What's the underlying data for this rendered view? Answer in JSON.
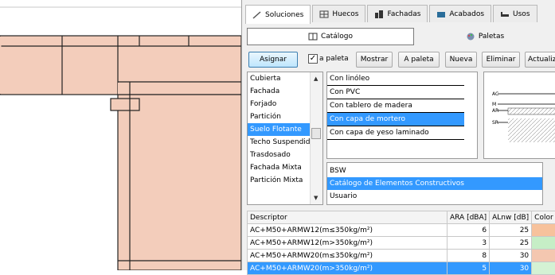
{
  "tabs": [
    "Soluciones",
    "Huecos",
    "Fachadas",
    "Acabados",
    "Usos"
  ],
  "subtabs": {
    "catalog": "Catálogo",
    "palettes": "Paletas"
  },
  "toolbar": {
    "assign": "Asignar",
    "to_palette_checkbox": "a paleta",
    "show": "Mostrar",
    "to_palette": "A paleta",
    "new": "Nueva",
    "delete": "Eliminar",
    "update": "Actualiz"
  },
  "categories": {
    "items": [
      "Cubierta",
      "Fachada",
      "Forjado",
      "Partición",
      "Suelo Flotante",
      "Techo Suspendido",
      "Trasdosado",
      "Fachada Mixta",
      "Partición Mixta"
    ],
    "selected": "Suelo Flotante"
  },
  "subcategories": {
    "items": [
      "Con linóleo",
      "Con PVC",
      "Con tablero de madera",
      "Con capa de mortero",
      "Con capa de yeso laminado"
    ],
    "selected": "Con capa de mortero"
  },
  "sources": {
    "items": [
      "BSW",
      "Catálogo de Elementos Constructivos",
      "Usuario"
    ],
    "selected": "Catálogo de Elementos Constructivos"
  },
  "preview_labels": [
    "AC",
    "M",
    "AR",
    "SR"
  ],
  "table": {
    "headers": [
      "Descriptor",
      "ARA [dBA]",
      "ALnw [dB]",
      "Color"
    ],
    "rows": [
      {
        "descriptor": "AC+M50+ARMW12(m≤350kg/m²)",
        "ara": "6",
        "alnw": "25",
        "color": "#f7c29c"
      },
      {
        "descriptor": "AC+M50+ARMW12(m>350kg/m²)",
        "ara": "3",
        "alnw": "25",
        "color": "#c6eec6"
      },
      {
        "descriptor": "AC+M50+ARMW20(m≤350kg/m²)",
        "ara": "8",
        "alnw": "30",
        "color": "#f4c7b0"
      },
      {
        "descriptor": "AC+M50+ARMW20(m>350kg/m²)",
        "ara": "5",
        "alnw": "30",
        "color": "#d4f2d4"
      }
    ],
    "selected_index": 3
  },
  "colors": {
    "wall_fill": "#f3cdbb",
    "selection": "#3399ff"
  }
}
